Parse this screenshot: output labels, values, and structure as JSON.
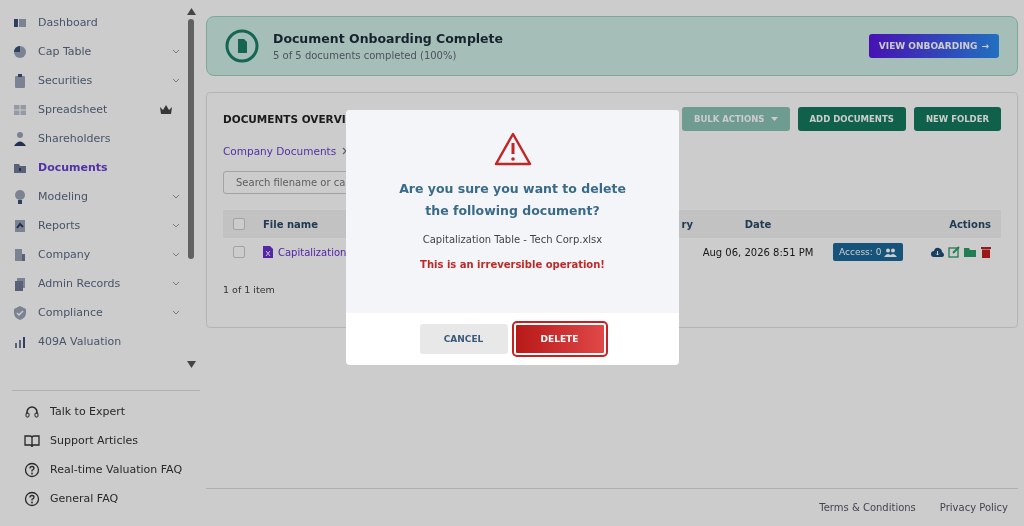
{
  "sidebar": {
    "items": [
      {
        "label": "Dashboard",
        "submenu": false,
        "premium": false,
        "selected": false
      },
      {
        "label": "Cap Table",
        "submenu": true,
        "premium": false,
        "selected": false
      },
      {
        "label": "Securities",
        "submenu": true,
        "premium": false,
        "selected": false
      },
      {
        "label": "Spreadsheet",
        "submenu": false,
        "premium": true,
        "selected": false
      },
      {
        "label": "Shareholders",
        "submenu": false,
        "premium": false,
        "selected": false
      },
      {
        "label": "Documents",
        "submenu": false,
        "premium": false,
        "selected": true
      },
      {
        "label": "Modeling",
        "submenu": true,
        "premium": false,
        "selected": false
      },
      {
        "label": "Reports",
        "submenu": true,
        "premium": false,
        "selected": false
      },
      {
        "label": "Company",
        "submenu": true,
        "premium": false,
        "selected": false
      },
      {
        "label": "Admin Records",
        "submenu": true,
        "premium": false,
        "selected": false
      },
      {
        "label": "Compliance",
        "submenu": true,
        "premium": false,
        "selected": false
      },
      {
        "label": "409A Valuation",
        "submenu": false,
        "premium": false,
        "selected": false
      }
    ],
    "help_links": [
      {
        "label": "Talk to Expert"
      },
      {
        "label": "Support Articles"
      },
      {
        "label": "Real-time Valuation FAQ"
      },
      {
        "label": "General FAQ"
      }
    ]
  },
  "banner": {
    "title": "Document Onboarding Complete",
    "subtitle": "5 of 5 documents completed (100%)",
    "button": "VIEW ONBOARDING",
    "button_icon": "→"
  },
  "documents": {
    "title": "DOCUMENTS OVERVI",
    "buttons": [
      {
        "label": "BULK ACTIONS",
        "kind": "dropdown"
      },
      {
        "label": "ADD DOCUMENTS",
        "kind": "plain"
      },
      {
        "label": "NEW FOLDER",
        "kind": "plain"
      }
    ],
    "breadcrumb": [
      "Company Documents"
    ],
    "search": {
      "placeholder": "Search filename or ca"
    },
    "table": {
      "columns": [
        "File name",
        "ry",
        "Date",
        "Actions"
      ],
      "header_checked": false,
      "rows": [
        {
          "checked": false,
          "file": "Capitalization",
          "date": "Aug 06, 2026 8:51 PM",
          "access": "Access: 0"
        }
      ]
    },
    "pager": "1 of 1 item"
  },
  "footer": {
    "links": [
      "Terms & Conditions",
      "Privacy Policy"
    ]
  },
  "dialog": {
    "question": "Are you sure you want to delete the following document?",
    "document": "Capitalization Table - Tech Corp.xlsx",
    "warning": "This is an irreversible operation!",
    "buttons": [
      {
        "label": "CANCEL",
        "kind": "secondary"
      },
      {
        "label": "DELETE",
        "kind": "danger"
      }
    ]
  }
}
